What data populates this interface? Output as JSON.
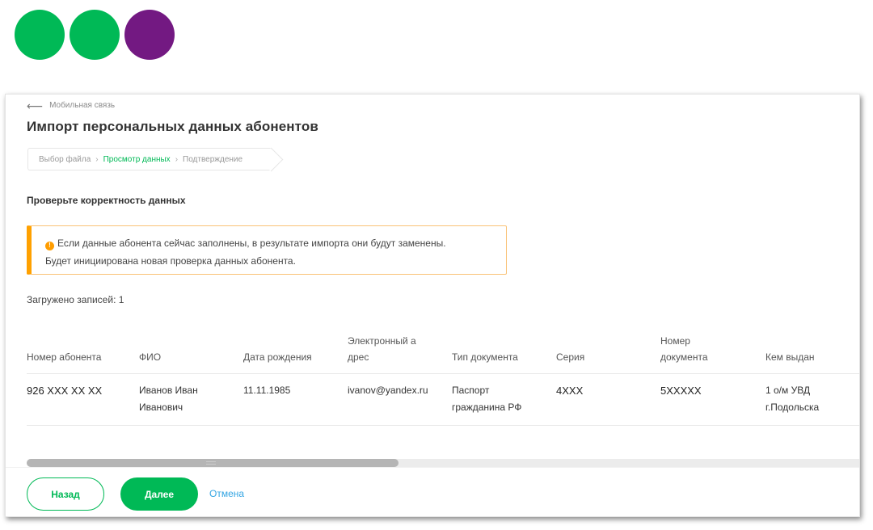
{
  "colors": {
    "brand_green": "#00b956",
    "brand_purple": "#731982",
    "warning": "#ffa100",
    "link": "#34a5e3"
  },
  "logo": {
    "dots": [
      "#00b956",
      "#00b956",
      "#731982"
    ]
  },
  "breadcrumb": {
    "back_label": "Мобильная связь"
  },
  "page": {
    "title": "Импорт персональных данных абонентов"
  },
  "stepper": {
    "steps": [
      "Выбор файла",
      "Просмотр данных",
      "Подтверждение"
    ],
    "active_index": 1
  },
  "section_title": "Проверьте корректность данных",
  "alert": {
    "icon": "warning-icon",
    "line1": "Если данные абонента сейчас заполнены, в результате импорта они будут заменены.",
    "line2": "Будет инициирована новая проверка данных абонента."
  },
  "records_count": "Загружено записей: 1",
  "table": {
    "headers": [
      "Номер абонента",
      "ФИО",
      "Дата рождения",
      "Электронный адрес",
      "Тип документа",
      "Серия",
      "Номер документа",
      "Кем выдан"
    ],
    "rows": [
      [
        "926 XXX XX XX",
        "Иванов Иван Иванович",
        "11.11.1985",
        "ivanov@yandex.ru",
        "Паспорт гражданина РФ",
        "4XXX",
        "5XXXXX",
        "1 о/м УВД г.Подольска"
      ]
    ]
  },
  "scrollbar": {
    "position": 0.0
  },
  "footer": {
    "back_label": "Назад",
    "next_label": "Далее",
    "cancel_label": "Отмена"
  }
}
